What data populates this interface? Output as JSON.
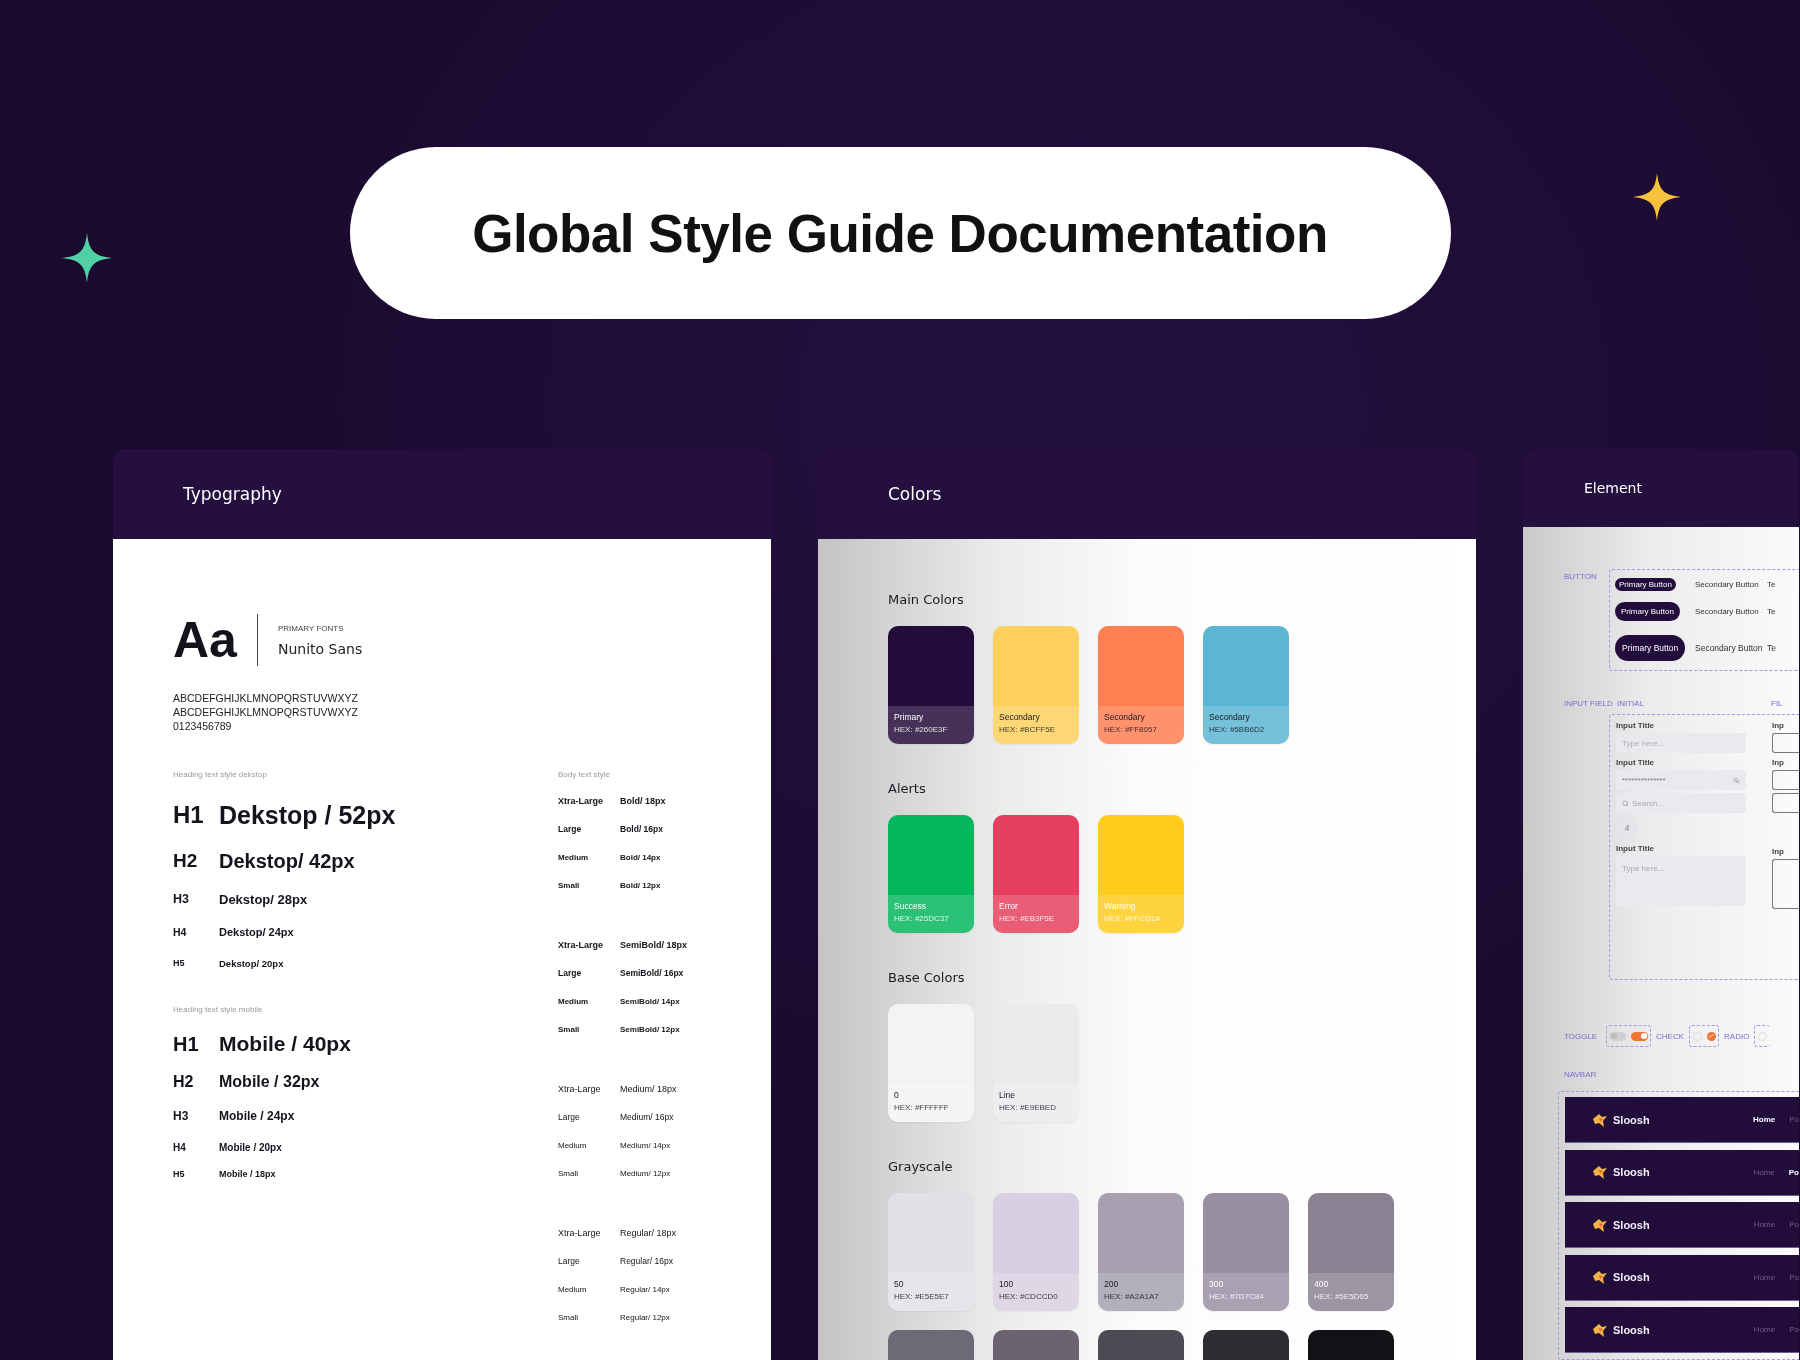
{
  "title": "Global Style Guide Documentation",
  "typography": {
    "heading": "Typography",
    "sample": "Aa",
    "font_caption": "PRIMARY FONTS",
    "font_name": "Nunito Sans",
    "alphabet": [
      "ABCDEFGHIJKLMNOPQRSTUVWXYZ",
      "ABCDEFGHIJKLMNOPQRSTUVWXYZ",
      "0123456789"
    ],
    "heading_groups": [
      {
        "label": "Heading text style dekstop",
        "rows": [
          {
            "tag": "H1",
            "spec": "Dekstop / 52px"
          },
          {
            "tag": "H2",
            "spec": "Dekstop/ 42px"
          },
          {
            "tag": "H3",
            "spec": "Dekstop/ 28px"
          },
          {
            "tag": "H4",
            "spec": "Dekstop/ 24px"
          },
          {
            "tag": "H5",
            "spec": "Dekstop/ 20px"
          }
        ]
      },
      {
        "label": "Heading text style mobile",
        "rows": [
          {
            "tag": "H1",
            "spec": "Mobile / 40px"
          },
          {
            "tag": "H2",
            "spec": "Mobile / 32px"
          },
          {
            "tag": "H3",
            "spec": "Mobile / 24px"
          },
          {
            "tag": "H4",
            "spec": "Mobile / 20px"
          },
          {
            "tag": "H5",
            "spec": "Mobile / 18px"
          }
        ]
      }
    ],
    "body_label": "Body text style",
    "body_groups": [
      {
        "kind": "bold",
        "rows": [
          {
            "size": "Xtra-Large",
            "spec": "Bold/ 18px"
          },
          {
            "size": "Large",
            "spec": "Bold/ 16px"
          },
          {
            "size": "Medium",
            "spec": "Bold/ 14px"
          },
          {
            "size": "Small",
            "spec": "Bold/ 12px"
          }
        ]
      },
      {
        "kind": "semibold",
        "rows": [
          {
            "size": "Xtra-Large",
            "spec": "SemiBold/ 18px"
          },
          {
            "size": "Large",
            "spec": "SemiBold/ 16px"
          },
          {
            "size": "Medium",
            "spec": "SemiBold/ 14px"
          },
          {
            "size": "Small",
            "spec": "SemiBold/ 12px"
          }
        ]
      },
      {
        "kind": "medium",
        "rows": [
          {
            "size": "Xtra-Large",
            "spec": "Medium/ 18px"
          },
          {
            "size": "Large",
            "spec": "Medium/ 16px"
          },
          {
            "size": "Medium",
            "spec": "Medium/ 14px"
          },
          {
            "size": "Small",
            "spec": "Medium/ 12px"
          }
        ]
      },
      {
        "kind": "regular",
        "rows": [
          {
            "size": "Xtra-Large",
            "spec": "Regular/ 18px"
          },
          {
            "size": "Large",
            "spec": "Regular/ 16px"
          },
          {
            "size": "Medium",
            "spec": "Regular/ 14px"
          },
          {
            "size": "Small",
            "spec": "Regular/ 12px"
          }
        ]
      }
    ]
  },
  "colors": {
    "heading": "Colors",
    "sections": [
      {
        "title": "Main Colors",
        "swatches": [
          {
            "name": "Primary",
            "hex": "HEX: #260E3F",
            "color": "#230b3a",
            "light_label": true
          },
          {
            "name": "Secondary",
            "hex": "HEX: #BCFF5E",
            "color": "#fdd05c",
            "light_label": false
          },
          {
            "name": "Secondary",
            "hex": "HEX: #FF8057",
            "color": "#ff7e52",
            "light_label": false
          },
          {
            "name": "Secondary",
            "hex": "HEX: #5BB6D2",
            "color": "#5bb6d3",
            "light_label": false
          }
        ]
      },
      {
        "title": "Alerts",
        "swatches": [
          {
            "name": "Success",
            "hex": "HEX: #25DC37",
            "color": "#03b65c",
            "light_label": true
          },
          {
            "name": "Error",
            "hex": "HEX: #EB3F5E",
            "color": "#e63e5e",
            "light_label": true
          },
          {
            "name": "Warning",
            "hex": "HEX: #FFCD1A",
            "color": "#fecc1a",
            "light_label": true
          }
        ]
      },
      {
        "title": "Base Colors",
        "swatches": [
          {
            "name": "0",
            "hex": "HEX: #FFFFFF",
            "color": "#f3f3f3",
            "light_label": false
          },
          {
            "name": "Line",
            "hex": "HEX: #E9EBED",
            "color": "#e9ebed",
            "light_label": false
          }
        ]
      },
      {
        "title": "Grayscale",
        "swatches": [
          {
            "name": "50",
            "hex": "HEX: #E5E5E7",
            "color": "#e3e0e7",
            "light_label": false
          },
          {
            "name": "100",
            "hex": "HEX: #CDCCD0",
            "color": "#d8d0e2",
            "light_label": false
          },
          {
            "name": "200",
            "hex": "HEX: #A2A1A7",
            "color": "#a6a0b1",
            "light_label": false
          },
          {
            "name": "300",
            "hex": "HEX: #7D7C84",
            "color": "#988fa3",
            "light_label": true
          },
          {
            "name": "400",
            "hex": "HEX: #5E5D65",
            "color": "#8a8193",
            "light_label": true
          }
        ],
        "more": [
          {
            "color": "#6e6977"
          },
          {
            "color": "#6b6470"
          },
          {
            "color": "#4e4a53"
          },
          {
            "color": "#2f2b32"
          },
          {
            "color": "#141116"
          }
        ]
      }
    ]
  },
  "element": {
    "heading": "Element",
    "buttons": {
      "label": "BUTTON",
      "rows": [
        {
          "primary": "Primary Button",
          "secondary": "Secondary Button",
          "third": "Te"
        },
        {
          "primary": "Primary Button",
          "secondary": "Secondary Button",
          "third": "Te"
        },
        {
          "primary": "Primary Button",
          "secondary": "Secondary Button",
          "third": "Te"
        }
      ]
    },
    "input_fields": {
      "label": "INPUT FIELD",
      "initial_label": "INITIAL",
      "filled_label": "FIL",
      "initial": [
        {
          "kind": "text",
          "title": "Input Title",
          "placeholder": "Type here..."
        },
        {
          "kind": "password",
          "title": "Input Title",
          "value": "**************"
        },
        {
          "kind": "search",
          "placeholder": "Search..."
        },
        {
          "kind": "stepper",
          "value": "4"
        },
        {
          "kind": "textarea",
          "title": "Input Title",
          "placeholder": "Type here..."
        }
      ],
      "filled_titles": [
        "Inp",
        "Inp",
        "Inp"
      ]
    },
    "controls": {
      "toggle_label": "TOGGLE",
      "toggles": [
        {
          "on": false
        },
        {
          "on": true
        }
      ],
      "check_label": "CHECK",
      "checks": [
        {
          "checked": false
        },
        {
          "checked": true
        }
      ],
      "radio_label": "RADIO",
      "radios": [
        {
          "selected": false
        }
      ]
    },
    "navbar": {
      "label": "NAVBAR",
      "bars": [
        {
          "brand": "Sloosh",
          "links": [
            {
              "label": "Home",
              "selected": true
            },
            {
              "label": "Po",
              "selected": false
            }
          ]
        },
        {
          "brand": "Sloosh",
          "links": [
            {
              "label": "Home",
              "selected": false
            },
            {
              "label": "Po",
              "selected": true
            }
          ]
        },
        {
          "brand": "Sloosh",
          "links": [
            {
              "label": "Home",
              "selected": false
            },
            {
              "label": "Po",
              "selected": false
            }
          ]
        },
        {
          "brand": "Sloosh",
          "links": [
            {
              "label": "Home",
              "selected": false
            },
            {
              "label": "Po",
              "selected": false
            }
          ]
        },
        {
          "brand": "Sloosh",
          "links": [
            {
              "label": "Home",
              "selected": false
            },
            {
              "label": "Po",
              "selected": false
            }
          ]
        }
      ]
    }
  }
}
